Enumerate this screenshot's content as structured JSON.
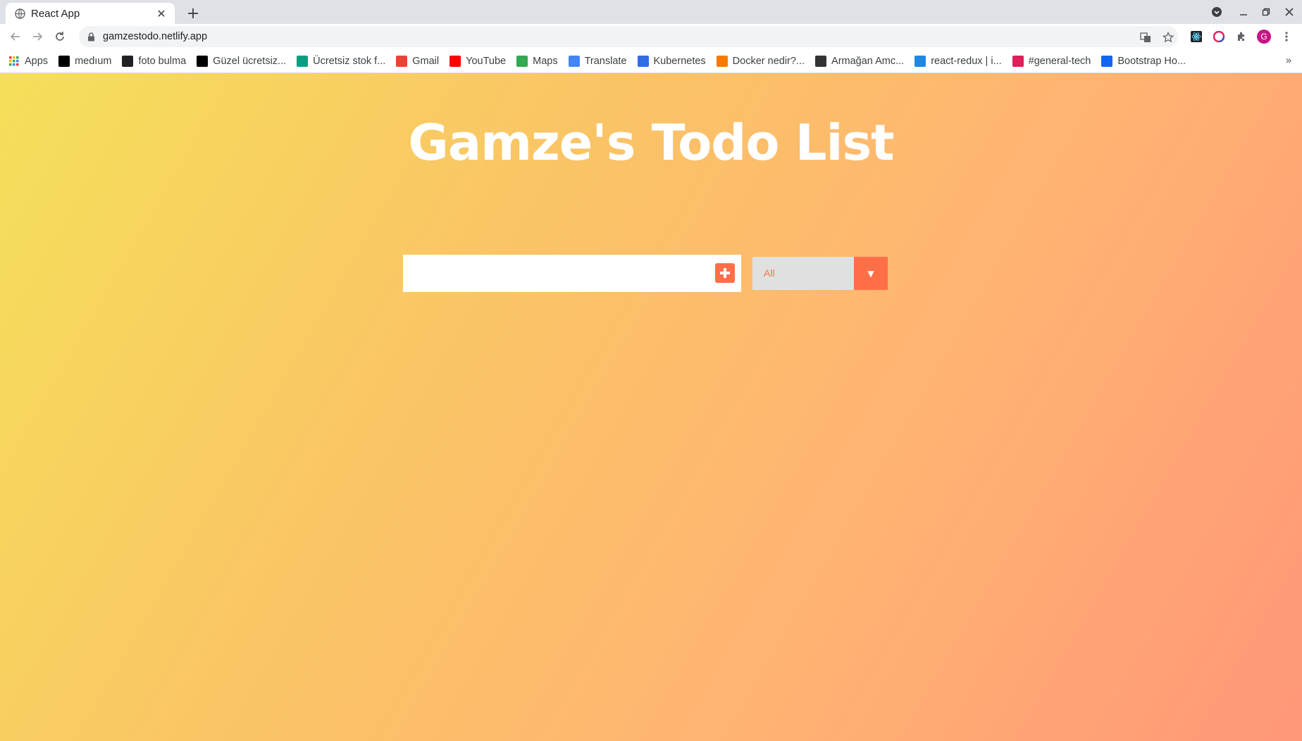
{
  "browser": {
    "tab": {
      "title": "React App",
      "close": "✕"
    },
    "new_tab": "+",
    "address": "gamzestodo.netlify.app"
  },
  "bookmarks": [
    {
      "label": "Apps",
      "icon": "apps-grid-icon",
      "color": "#4285f4"
    },
    {
      "label": "medıum",
      "icon": "medium-icon",
      "color": "#000000"
    },
    {
      "label": "foto bulma",
      "icon": "foto-bulma-icon",
      "color": "#202124"
    },
    {
      "label": "Güzel ücretsiz...",
      "icon": "unsplash-icon",
      "color": "#000000"
    },
    {
      "label": "Ücretsiz stok f...",
      "icon": "pexels-icon",
      "color": "#05a081"
    },
    {
      "label": "Gmail",
      "icon": "gmail-icon",
      "color": "#ea4335"
    },
    {
      "label": "YouTube",
      "icon": "youtube-icon",
      "color": "#ff0000"
    },
    {
      "label": "Maps",
      "icon": "maps-icon",
      "color": "#34a853"
    },
    {
      "label": "Translate",
      "icon": "translate-icon",
      "color": "#4285f4"
    },
    {
      "label": "Kubernetes",
      "icon": "kubernetes-icon",
      "color": "#326ce5"
    },
    {
      "label": "Docker nedir?...",
      "icon": "docker-icon",
      "color": "#f57c00"
    },
    {
      "label": "Armağan Amc...",
      "icon": "armagan-icon",
      "color": "#333333"
    },
    {
      "label": "react-redux | i...",
      "icon": "react-redux-icon",
      "color": "#1e88e5"
    },
    {
      "label": "#general-tech",
      "icon": "slack-icon",
      "color": "#e01e5a"
    },
    {
      "label": "Bootstrap Ho...",
      "icon": "mdb-icon",
      "color": "#1266f1"
    }
  ],
  "bookmarks_more": "»",
  "app": {
    "title": "Gamze's Todo List",
    "input_value": "",
    "filter_selected": "All",
    "filter_arrow": "▼"
  },
  "colors": {
    "accent": "#ff6f47",
    "gradient_start": "#f5df5a",
    "gradient_end": "#ff9778"
  }
}
